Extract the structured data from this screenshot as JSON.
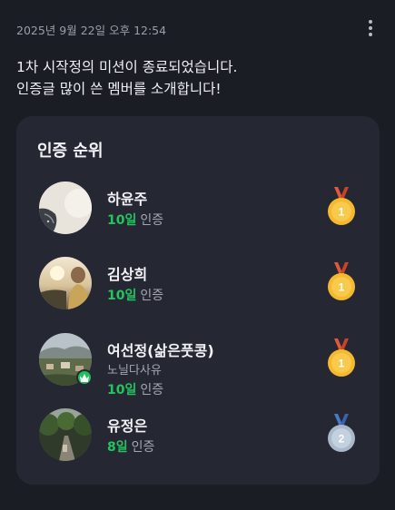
{
  "post": {
    "timestamp": "2025년 9월 22일 오후 12:54",
    "menu_icon": "kebab-menu-icon",
    "message_line1": "1차 시작정의 미션이 종료되었습니다.",
    "message_line2": "인증글 많이 쓴 멤버를 소개합니다!"
  },
  "ranking": {
    "title": "인증 순위",
    "members": [
      {
        "name": "하윤주",
        "subtitle": "",
        "days": "10일",
        "label": "인증",
        "medal": "gold",
        "rank": "1"
      },
      {
        "name": "김상희",
        "subtitle": "",
        "days": "10일",
        "label": "인증",
        "medal": "gold",
        "rank": "1"
      },
      {
        "name": "여선정(삶은풋콩)",
        "subtitle": "노닐다사유",
        "days": "10일",
        "label": "인증",
        "medal": "gold",
        "rank": "1",
        "leader": true
      },
      {
        "name": "유정은",
        "subtitle": "",
        "days": "8일",
        "label": "인증",
        "medal": "silver",
        "rank": "2"
      }
    ]
  },
  "colors": {
    "background": "#1b1d25",
    "card": "#252833",
    "accent_green": "#22c55e",
    "gold": "#f5b82e",
    "silver": "#b9c6d6",
    "ribbon_red": "#e05a3a",
    "ribbon_blue": "#4a78c9"
  }
}
